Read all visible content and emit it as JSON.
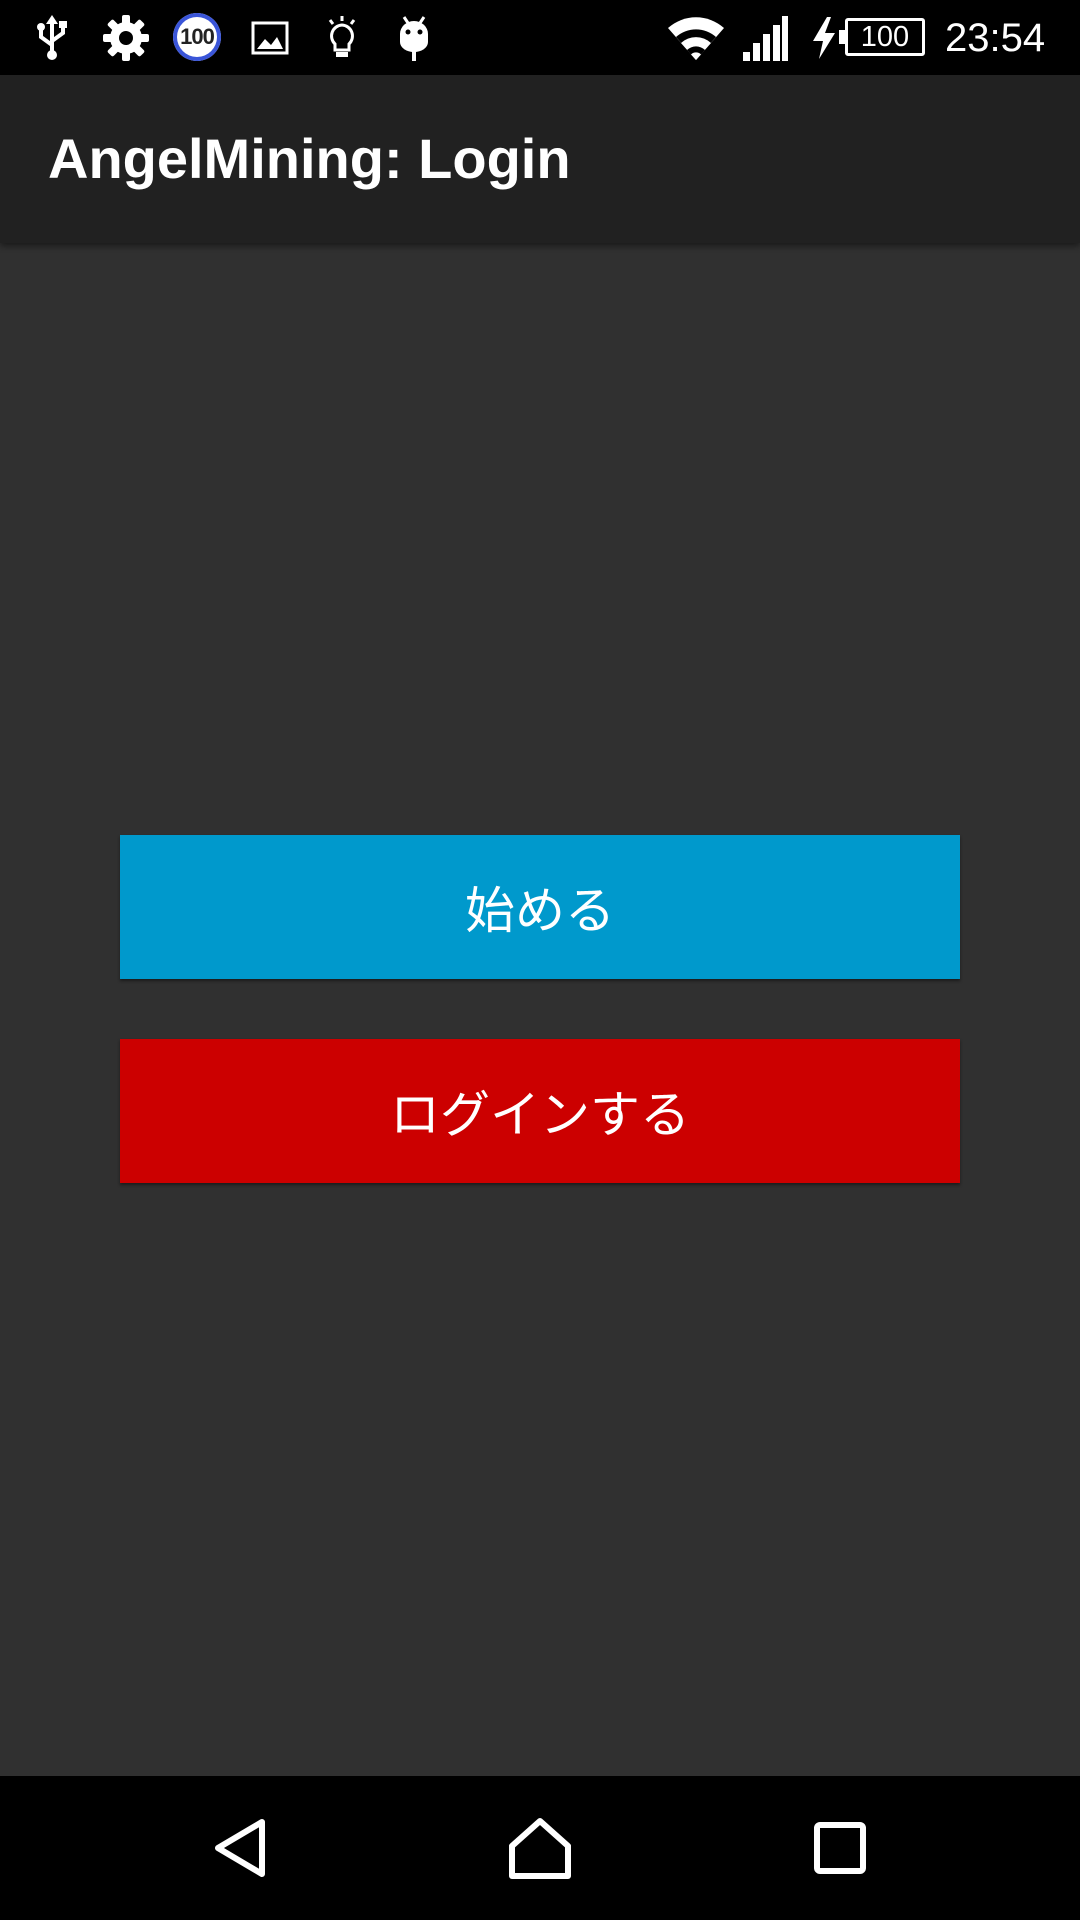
{
  "status_bar": {
    "notification_badge": "100",
    "battery_level": "100",
    "time": "23:54",
    "icons": [
      "usb-icon",
      "settings-icon",
      "image-icon",
      "lightbulb-icon",
      "android-icon",
      "wifi-icon",
      "signal-icon",
      "charging-icon",
      "battery-icon"
    ]
  },
  "app_bar": {
    "title": "AngelMining: Login"
  },
  "main": {
    "start_button_label": "始める",
    "login_button_label": "ログインする"
  },
  "nav_bar": {
    "icons": [
      "back-icon",
      "home-icon",
      "recents-icon"
    ]
  },
  "colors": {
    "background": "#303030",
    "app_bar": "#212121",
    "start_button": "#0099cc",
    "login_button": "#cc0000"
  }
}
